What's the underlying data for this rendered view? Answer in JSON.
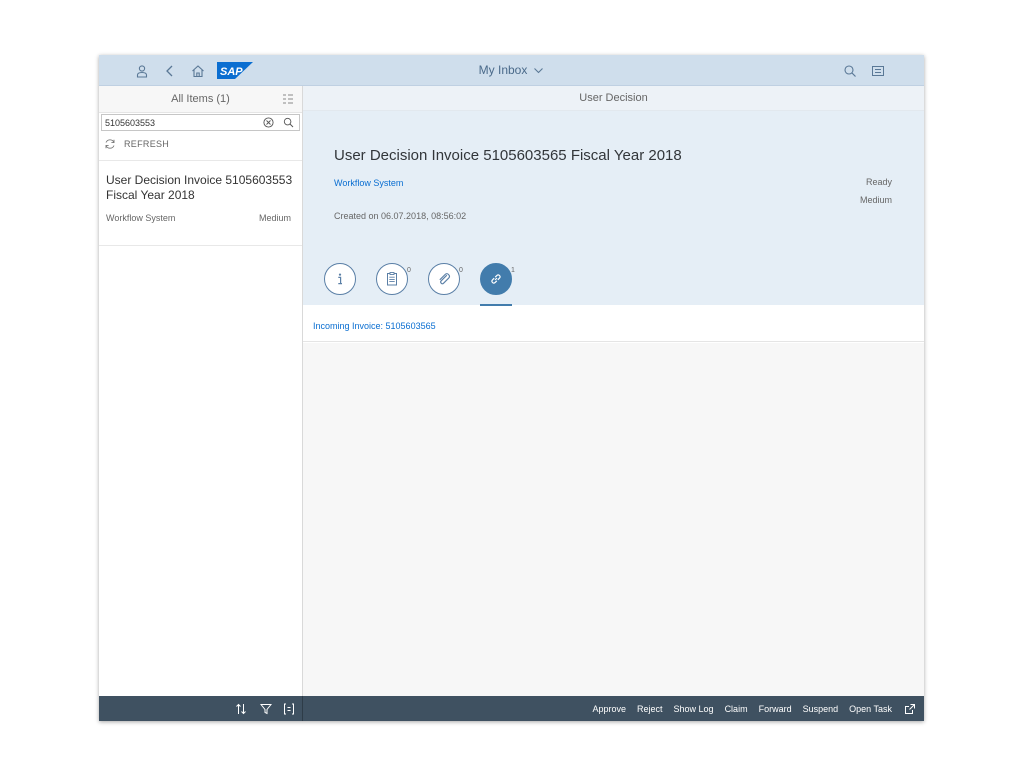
{
  "shell": {
    "title": "My Inbox",
    "logo_text": "SAP",
    "brand_color": "#0a6ed1",
    "icons": [
      "user-icon",
      "back-icon",
      "home-icon",
      "search-icon",
      "notifications-icon"
    ]
  },
  "master": {
    "header": "All Items (1)",
    "search_value": "5105603553",
    "refresh_label": "REFRESH",
    "items": [
      {
        "title": "User Decision Invoice 5105603553 Fiscal Year 2018",
        "system": "Workflow System",
        "priority": "Medium"
      }
    ]
  },
  "detail": {
    "header": "User Decision",
    "title": "User Decision Invoice 5105603565 Fiscal Year 2018",
    "system_link": "Workflow System",
    "status": "Ready",
    "priority": "Medium",
    "created": "Created on 06.07.2018, 08:56:02",
    "tabs": [
      {
        "name": "info",
        "icon": "info-icon",
        "count": ""
      },
      {
        "name": "notes",
        "icon": "notes-icon",
        "count": "0"
      },
      {
        "name": "attachments",
        "icon": "attachment-icon",
        "count": "0"
      },
      {
        "name": "related-objects",
        "icon": "link-icon",
        "count": "1"
      }
    ],
    "active_tab": "related-objects",
    "related_object": "Incoming Invoice: 5105603565"
  },
  "footer": {
    "actions": [
      "Approve",
      "Reject",
      "Show Log",
      "Claim",
      "Forward",
      "Suspend",
      "Open Task"
    ]
  },
  "colors": {
    "shell_bg": "#cfdeec",
    "footer_bg": "#3f5161",
    "object_header_bg": "#e5eef6",
    "active_tab": "#427cac",
    "link": "#0a6ed1"
  }
}
